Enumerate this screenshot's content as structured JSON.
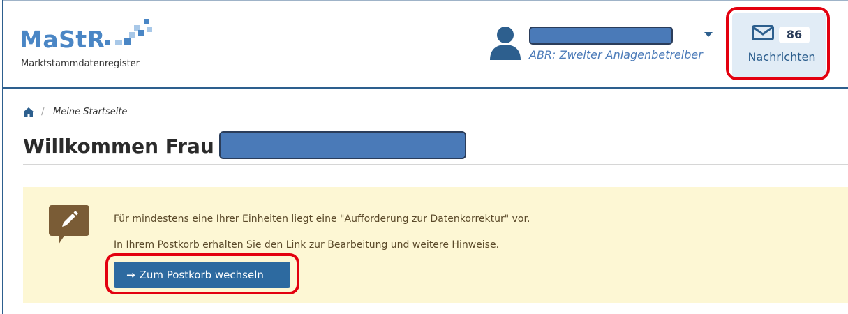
{
  "header": {
    "logo": {
      "wordmark": "MaStR",
      "subtitle": "Marktstammdatenregister"
    },
    "user": {
      "name": "",
      "role": "ABR: Zweiter Anlagenbetreiber",
      "avatar_icon": "user-icon",
      "menu_icon": "caret-down-icon"
    },
    "messages": {
      "icon": "envelope-icon",
      "count": "86",
      "label": "Nachrichten"
    }
  },
  "breadcrumb": {
    "home_icon": "home-icon",
    "separator": "/",
    "current": "Meine Startseite"
  },
  "page": {
    "title": "Willkommen Frau",
    "title_name": ""
  },
  "notice": {
    "icon": "edit-comment-icon",
    "line1": "Für mindestens eine Ihrer Einheiten liegt eine \"Aufforderung zur Datenkorrektur\" vor.",
    "line2": "In Ihrem Postkorb erhalten Sie den Link zur Bearbeitung und weitere Hinweise.",
    "button_arrow": "→",
    "button_label": "Zum Postkorb wechseln"
  },
  "colors": {
    "brand_blue": "#4a86c5",
    "header_rule": "#2d5f8e",
    "button_blue": "#2d6aa0",
    "notice_bg": "#fdf7d4",
    "notice_icon": "#7a5c36",
    "highlight_red": "#e3000f",
    "redaction_blue": "#4a7ab8"
  }
}
